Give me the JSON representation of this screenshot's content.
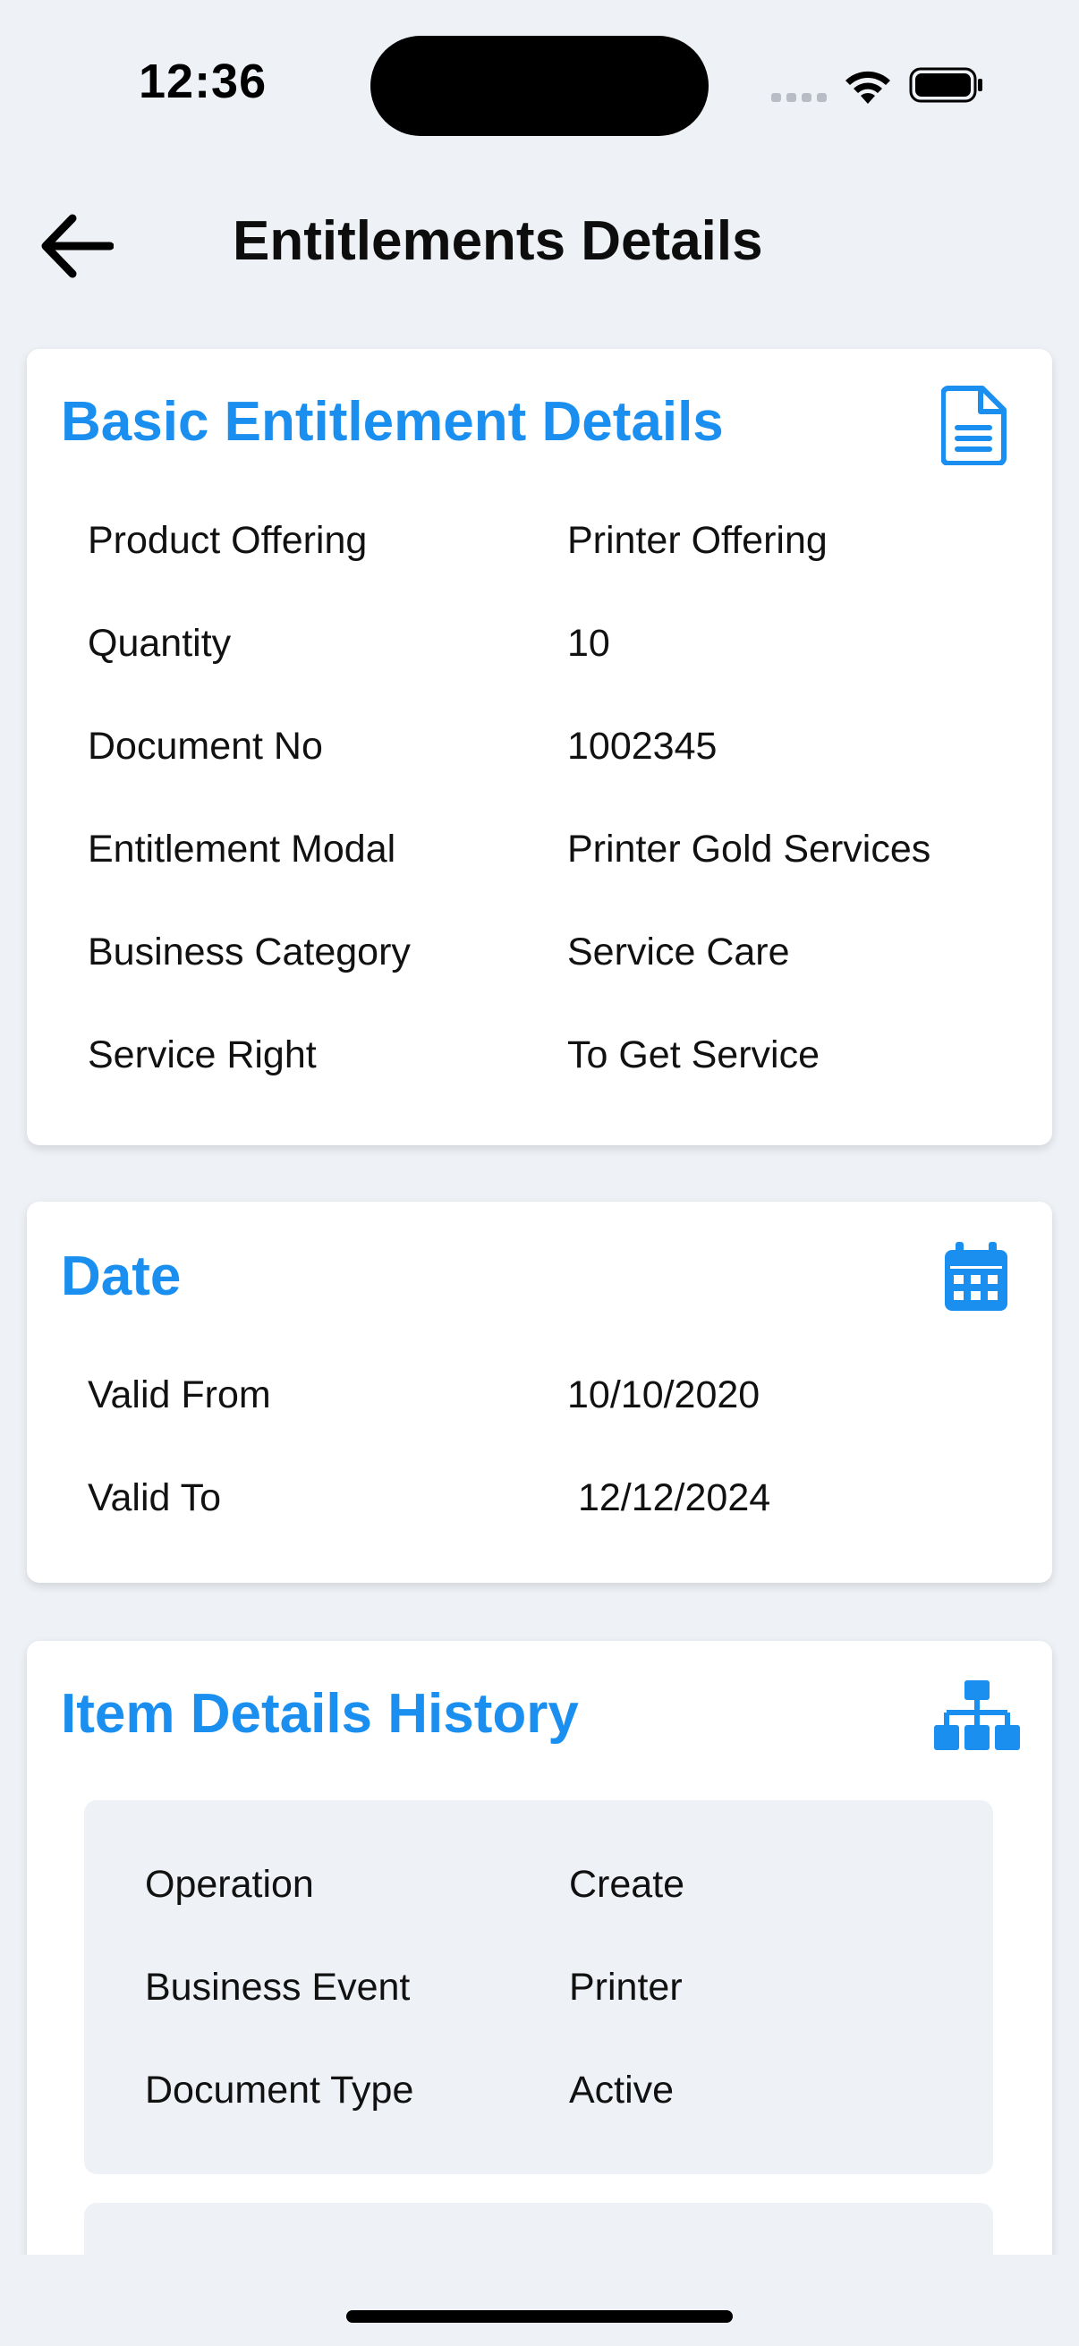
{
  "status_bar": {
    "time": "12:36"
  },
  "header": {
    "title": "Entitlements Details",
    "back_icon": "arrow-left-icon"
  },
  "colors": {
    "accent": "#1a8fef",
    "background": "#eef1f6",
    "card": "#ffffff"
  },
  "basic": {
    "title": "Basic Entitlement Details",
    "icon": "document-icon",
    "rows": [
      {
        "label": "Product Offering",
        "value": "Printer Offering"
      },
      {
        "label": "Quantity",
        "value": "10"
      },
      {
        "label": "Document No",
        "value": "1002345"
      },
      {
        "label": "Entitlement Modal",
        "value": "Printer Gold Services"
      },
      {
        "label": "Business Category",
        "value": "Service Care"
      },
      {
        "label": "Service Right",
        "value": "To Get Service"
      }
    ]
  },
  "date": {
    "title": "Date",
    "icon": "calendar-icon",
    "rows": [
      {
        "label": "Valid From",
        "value": "10/10/2020"
      },
      {
        "label": "Valid To",
        "value": " 12/12/2024"
      }
    ]
  },
  "history": {
    "title": "Item Details History",
    "icon": "sitemap-icon",
    "items": [
      {
        "rows": [
          {
            "label": "Operation",
            "value": "Create"
          },
          {
            "label": "Business Event",
            "value": "Printer"
          },
          {
            "label": "Document Type",
            "value": "Active"
          }
        ]
      }
    ]
  }
}
